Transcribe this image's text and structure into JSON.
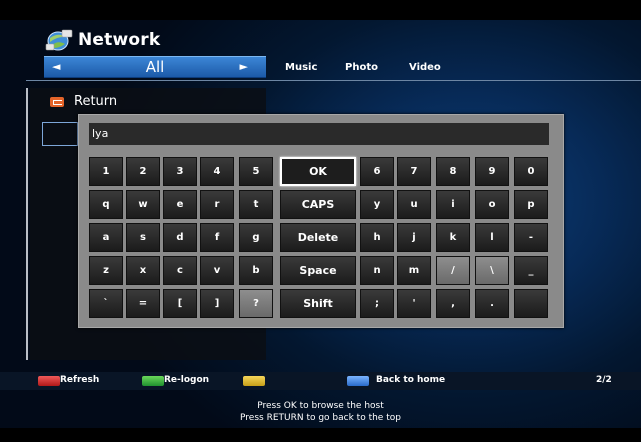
{
  "header": {
    "title": "Network",
    "icon": "network-globe-icon"
  },
  "category": {
    "selected": "All",
    "left_arrow": "◄",
    "right_arrow": "►",
    "tabs": [
      "Music",
      "Photo",
      "Video"
    ]
  },
  "list": {
    "return_label": "Return"
  },
  "keyboard": {
    "input_value": "lya",
    "rows": [
      [
        "1",
        "2",
        "3",
        "4",
        "5",
        "OK",
        "6",
        "7",
        "8",
        "9",
        "0"
      ],
      [
        "q",
        "w",
        "e",
        "r",
        "t",
        "CAPS",
        "y",
        "u",
        "i",
        "o",
        "p"
      ],
      [
        "a",
        "s",
        "d",
        "f",
        "g",
        "Delete",
        "h",
        "j",
        "k",
        "l",
        "-"
      ],
      [
        "z",
        "x",
        "c",
        "v",
        "b",
        "Space",
        "n",
        "m",
        "/",
        "\\",
        "_"
      ],
      [
        "`",
        "=",
        "[",
        "]",
        "?",
        "Shift",
        ";",
        "'",
        ",",
        ".",
        " "
      ]
    ],
    "selected_key": "OK"
  },
  "footer": {
    "buttons": [
      {
        "color": "#c8242a",
        "label": "Refresh"
      },
      {
        "color": "#2fa83a",
        "label": "Re-logon"
      },
      {
        "color": "#e0b020",
        "label": ""
      },
      {
        "color": "#3a7ad6",
        "label": "Back to home"
      }
    ],
    "page": "2/2"
  },
  "messages": [
    "Press OK to browse the host",
    "Press RETURN to go back to the top"
  ]
}
